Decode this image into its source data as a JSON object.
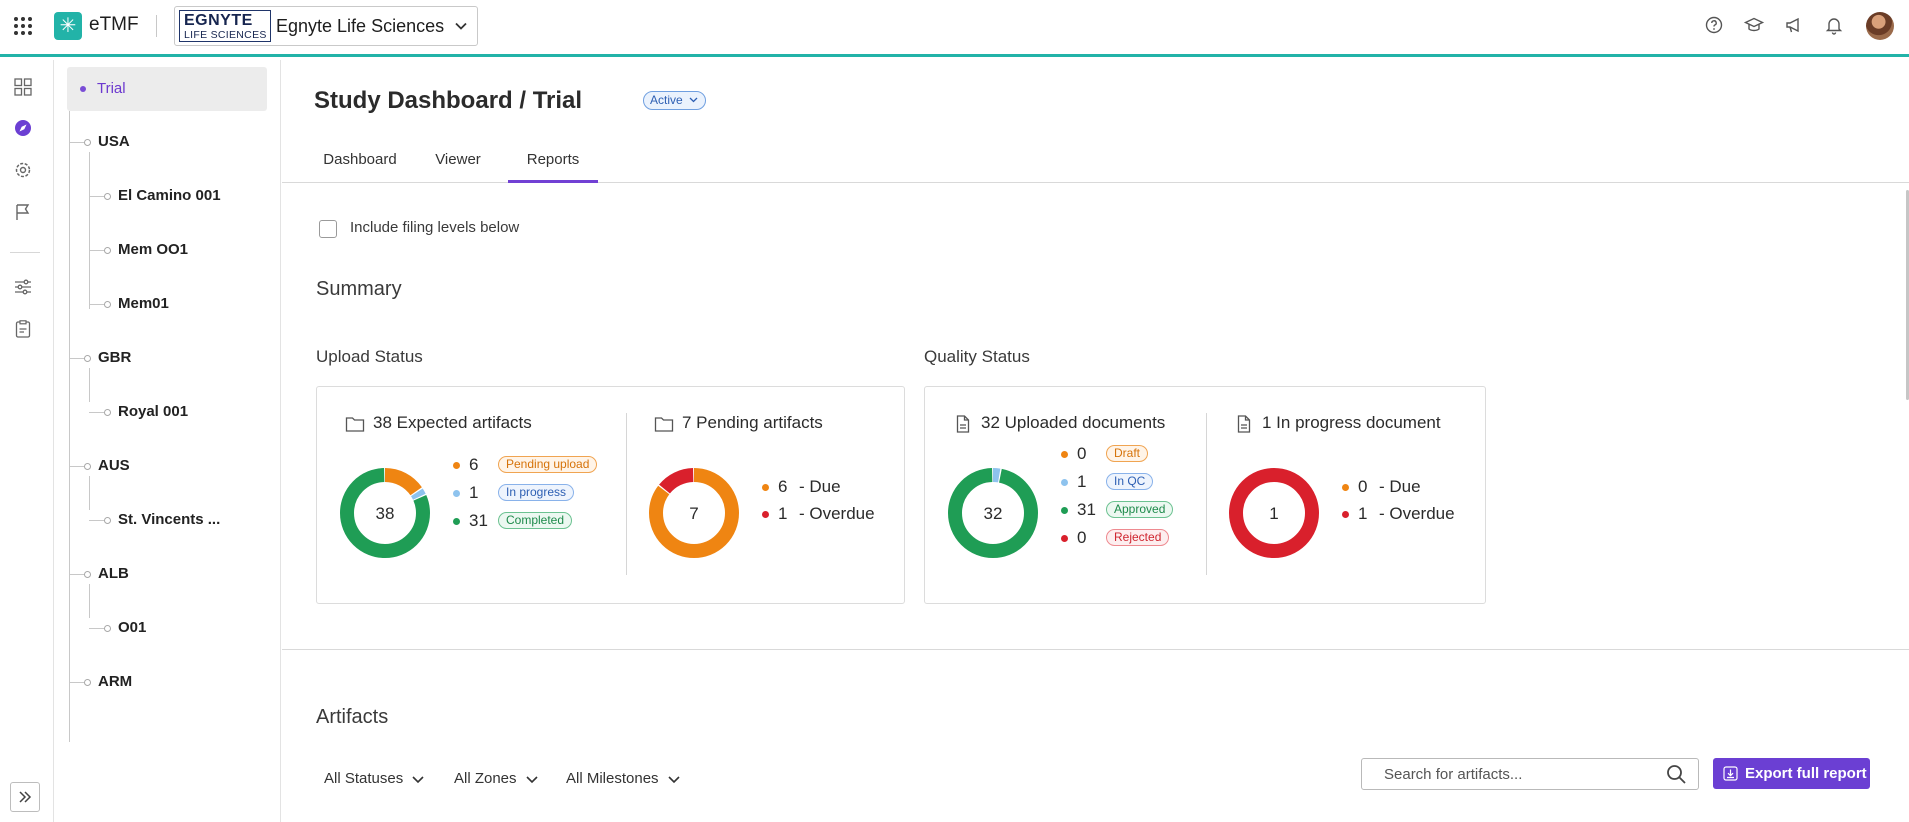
{
  "topbar": {
    "app_name": "eTMF",
    "org_logo_line1": "EGNYTE",
    "org_logo_line2": "LIFE SCIENCES",
    "org_name": "Egnyte Life Sciences",
    "icons": [
      "help-icon",
      "learning-icon",
      "announcements-icon",
      "notifications-icon"
    ],
    "accent_color": "#22b3a8"
  },
  "rail": {
    "icons": [
      "dashboard-grid-icon",
      "compass-icon",
      "settings-icon",
      "flag-icon",
      "sliders-icon",
      "clipboard-icon",
      "expand-icon"
    ]
  },
  "tree": {
    "root": "Trial",
    "nodes": [
      {
        "label": "USA",
        "level": 1
      },
      {
        "label": "El Camino 001",
        "level": 2
      },
      {
        "label": "Mem OO1",
        "level": 2
      },
      {
        "label": "Mem01",
        "level": 2
      },
      {
        "label": "GBR",
        "level": 1
      },
      {
        "label": "Royal 001",
        "level": 2
      },
      {
        "label": "AUS",
        "level": 1
      },
      {
        "label": "St. Vincents ...",
        "level": 2
      },
      {
        "label": "ALB",
        "level": 1
      },
      {
        "label": "O01",
        "level": 2
      },
      {
        "label": "ARM",
        "level": 1
      }
    ]
  },
  "main": {
    "title": "Study Dashboard / Trial",
    "status": "Active",
    "tabs": [
      "Dashboard",
      "Viewer",
      "Reports"
    ],
    "active_tab": "Reports",
    "include_label": "Include filing levels below",
    "summary_title": "Summary",
    "upload_status_title": "Upload Status",
    "quality_status_title": "Quality Status",
    "expected": {
      "heading": "38 Expected artifacts",
      "center": "38",
      "items": [
        {
          "count": "6",
          "label": "Pending upload",
          "value": 6,
          "color": "#ef8512"
        },
        {
          "count": "1",
          "label": "In progress",
          "value": 1,
          "color": "#8ec3ee"
        },
        {
          "count": "31",
          "label": "Completed",
          "value": 31,
          "color": "#1f9d55"
        }
      ]
    },
    "pending": {
      "heading": "7 Pending artifacts",
      "center": "7",
      "items": [
        {
          "count": "6",
          "label": "- Due",
          "value": 6,
          "color": "#ef8512"
        },
        {
          "count": "1",
          "label": "- Overdue",
          "value": 1,
          "color": "#d9202c"
        }
      ]
    },
    "uploaded": {
      "heading": "32 Uploaded documents",
      "center": "32",
      "items": [
        {
          "count": "0",
          "label": "Draft",
          "value": 0,
          "color": "#ef8512"
        },
        {
          "count": "1",
          "label": "In QC",
          "value": 1,
          "color": "#8ec3ee"
        },
        {
          "count": "31",
          "label": "Approved",
          "value": 31,
          "color": "#1f9d55"
        },
        {
          "count": "0",
          "label": "Rejected",
          "value": 0,
          "color": "#d9202c"
        }
      ]
    },
    "inprogress": {
      "heading": "1 In progress document",
      "center": "1",
      "items": [
        {
          "count": "0",
          "label": "- Due",
          "value": 0,
          "color": "#ef8512"
        },
        {
          "count": "1",
          "label": "- Overdue",
          "value": 1,
          "color": "#d9202c"
        }
      ]
    },
    "artifacts_title": "Artifacts",
    "filters": [
      "All Statuses",
      "All Zones",
      "All Milestones"
    ],
    "search_placeholder": "Search for artifacts...",
    "export_label": "Export full report",
    "brand_color": "#6b3fd3"
  }
}
